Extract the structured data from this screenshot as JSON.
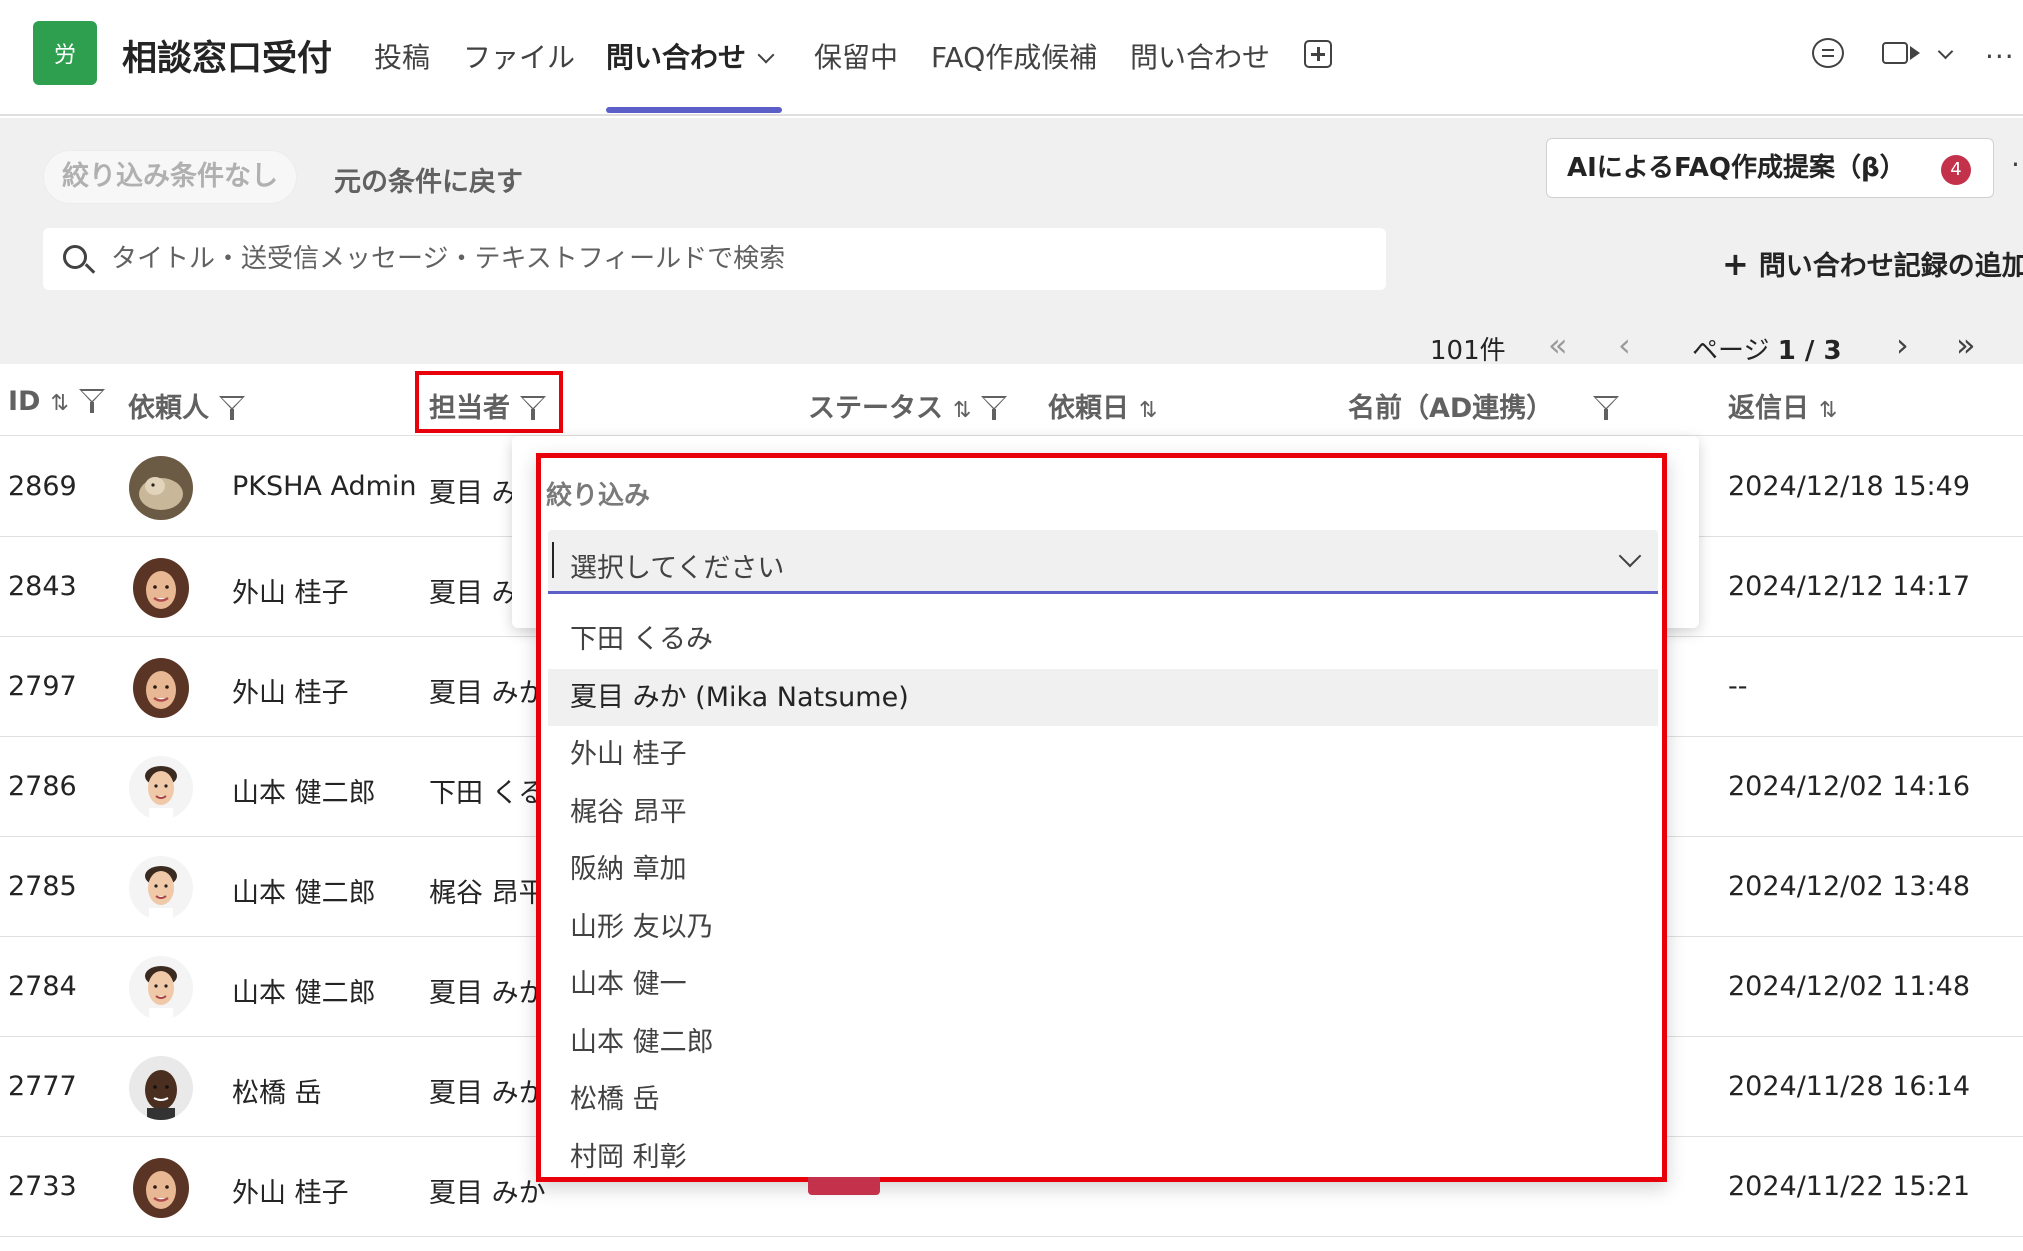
{
  "header": {
    "logo_text": "労",
    "app_title": "相談窓口受付",
    "tabs": [
      "投稿",
      "ファイル",
      "問い合わせ",
      "保留中",
      "FAQ作成候補",
      "問い合わせ"
    ],
    "active_tab_index": 2,
    "more_label": "···"
  },
  "toolbar": {
    "filter_chip": "絞り込み条件なし",
    "reset_label": "元の条件に戻す",
    "ai_button": "AIによるFAQ作成提案（β）",
    "ai_badge": "4",
    "search_placeholder": "タイトル・送受信メッセージ・テキストフィールドで検索",
    "add_record": "問い合わせ記録の追加",
    "count": "101件",
    "page_prefix": "ページ",
    "page_value": "1 / 3"
  },
  "table": {
    "columns": [
      "ID",
      "依頼人",
      "担当者",
      "ステータス",
      "依頼日",
      "名前（AD連携）",
      "返信日"
    ],
    "rows": [
      {
        "id": "2869",
        "requester": "PKSHA Admin",
        "assignee": "夏目 み",
        "reply": "2024/12/18 15:49",
        "avatar": "cat"
      },
      {
        "id": "2843",
        "requester": "外山 桂子",
        "assignee": "夏目 み",
        "reply": "2024/12/12 14:17",
        "avatar": "woman"
      },
      {
        "id": "2797",
        "requester": "外山 桂子",
        "assignee": "夏目 みか",
        "reply": "--",
        "avatar": "woman"
      },
      {
        "id": "2786",
        "requester": "山本 健二郎",
        "assignee": "下田 くる",
        "reply": "2024/12/02 14:16",
        "avatar": "man"
      },
      {
        "id": "2785",
        "requester": "山本 健二郎",
        "assignee": "梶谷 昂平",
        "reply": "2024/12/02 13:48",
        "avatar": "man"
      },
      {
        "id": "2784",
        "requester": "山本 健二郎",
        "assignee": "夏目 みか",
        "reply": "2024/12/02 11:48",
        "avatar": "man"
      },
      {
        "id": "2777",
        "requester": "松橋 岳",
        "assignee": "夏目 みか",
        "reply": "2024/11/28 16:14",
        "avatar": "man2"
      },
      {
        "id": "2733",
        "requester": "外山 桂子",
        "assignee": "夏目 みか",
        "reply": "2024/11/22 15:21",
        "avatar": "woman"
      }
    ]
  },
  "dropdown": {
    "label": "絞り込み",
    "placeholder": "選択してください",
    "options": [
      "下田 くるみ",
      "夏目 みか (Mika Natsume)",
      "外山 桂子",
      "梶谷 昂平",
      "阪納 章加",
      "山形 友以乃",
      "山本 健一",
      "山本 健二郎",
      "松橋 岳",
      "村岡 利彰"
    ],
    "hover_index": 1
  },
  "colors": {
    "accent": "#5b5fc7",
    "highlight": "#e8000b",
    "logo": "#2e9e4f",
    "badge": "#c4314b"
  }
}
